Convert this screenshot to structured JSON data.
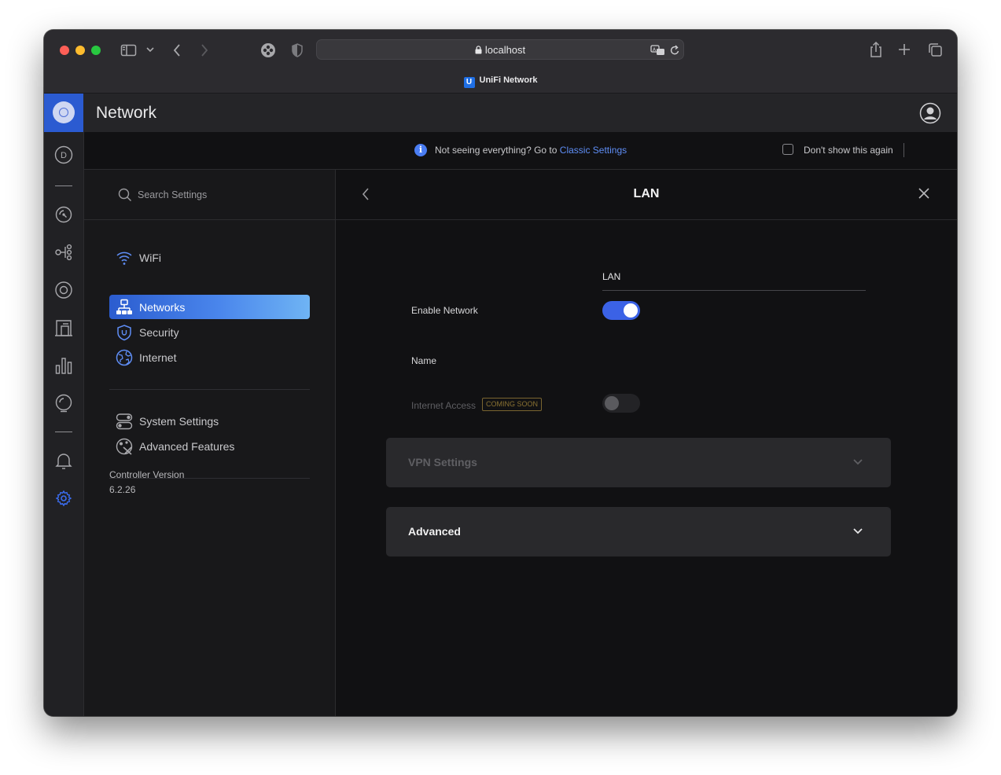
{
  "browser": {
    "url": "localhost",
    "tab_title": "UniFi Network",
    "favicon_letter": "U"
  },
  "app": {
    "title": "Network"
  },
  "left_nav": {
    "dashboard_letter": "D",
    "items": [
      "dashboard-icon",
      "topology-icon",
      "devices-icon",
      "clients-icon",
      "insights-icon",
      "statistics-icon",
      "support-icon",
      "alerts-icon",
      "settings-icon"
    ]
  },
  "banner": {
    "info_glyph": "i",
    "message": "Not seeing everything? Go to",
    "link_text": "Classic Settings",
    "dont_show": "Don't show this again"
  },
  "settings_panel": {
    "search_placeholder": "Search Settings",
    "menu": [
      {
        "label": "WiFi"
      },
      {
        "label": "Networks",
        "active": true
      },
      {
        "label": "Security"
      },
      {
        "label": "Internet"
      }
    ],
    "menu2": [
      {
        "label": "System Settings"
      },
      {
        "label": "Advanced Features"
      }
    ],
    "version_label": "Controller Version",
    "version_value": "6.2.26"
  },
  "detail": {
    "title": "LAN",
    "enable_network_label": "Enable Network",
    "enable_network_on": true,
    "name_label": "Name",
    "name_value": "LAN",
    "internet_access_label": "Internet Access",
    "internet_access_badge": "COMING SOON",
    "internet_access_on": false,
    "vpn_section": "VPN Settings",
    "advanced_section": "Advanced"
  },
  "colors": {
    "accent": "#3b62e6",
    "link": "#5f8ef6",
    "active_item_start": "#2b5ccf",
    "active_item_end": "#6fb4f4"
  }
}
